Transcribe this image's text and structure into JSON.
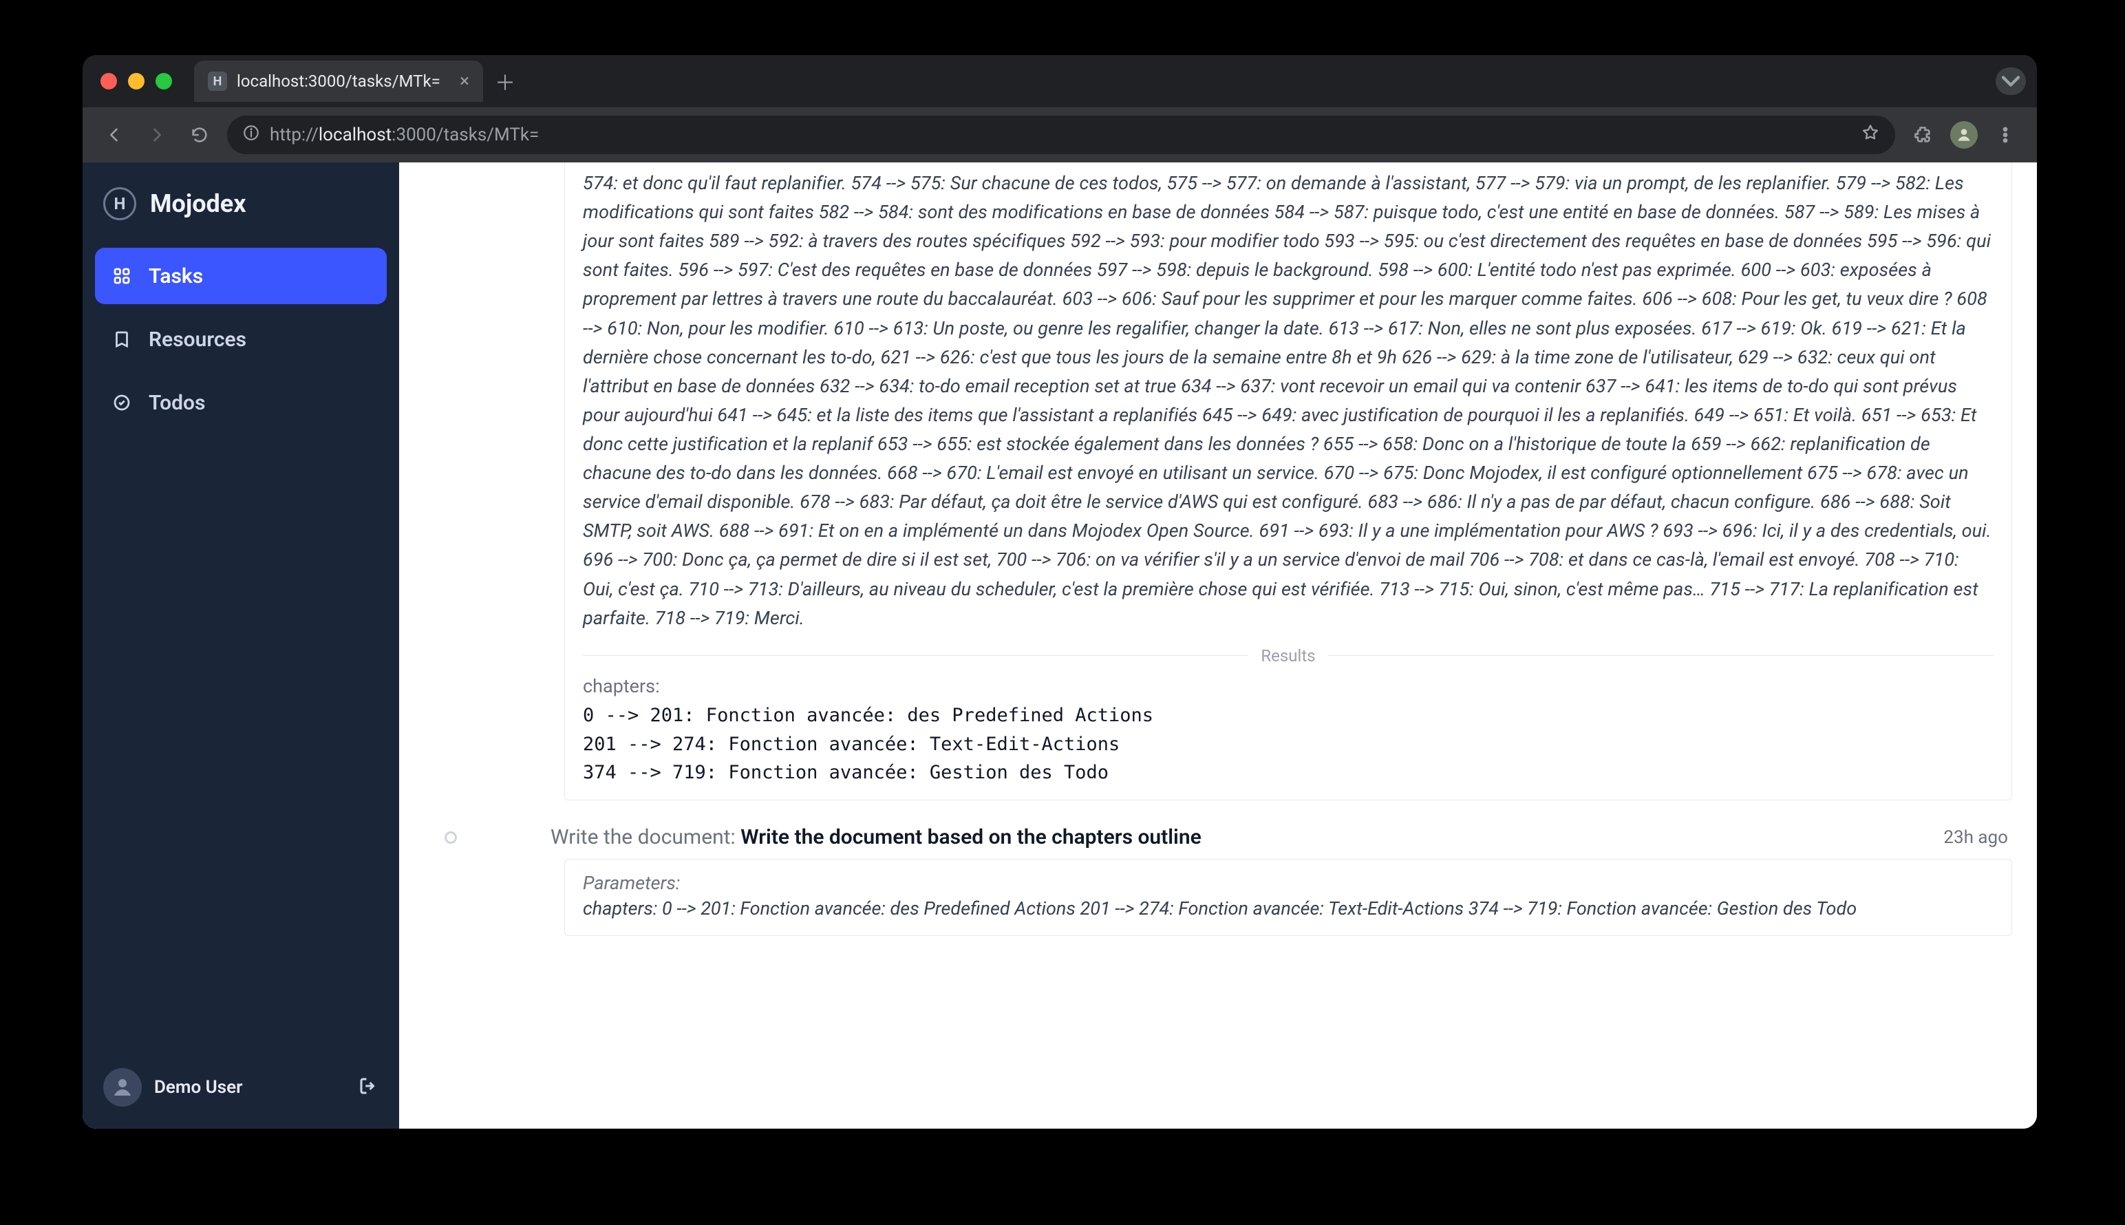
{
  "chrome": {
    "tab_title": "localhost:3000/tasks/MTk=",
    "favicon_letter": "H",
    "url_scheme": "http://",
    "url_host": "localhost",
    "url_rest": ":3000/tasks/MTk="
  },
  "app": {
    "brand": "Mojodex",
    "nav": {
      "tasks": "Tasks",
      "resources": "Resources",
      "todos": "Todos"
    },
    "user": {
      "name": "Demo User"
    }
  },
  "content": {
    "transcript": "574: et donc qu'il faut replanifier. 574 --> 575: Sur chacune de ces todos, 575 --> 577: on demande à l'assistant, 577 --> 579: via un prompt, de les replanifier. 579 --> 582: Les modifications qui sont faites 582 --> 584: sont des modifications en base de données 584 --> 587: puisque todo, c'est une entité en base de données. 587 --> 589: Les mises à jour sont faites 589 --> 592: à travers des routes spécifiques 592 --> 593: pour modifier todo 593 --> 595: ou c'est directement des requêtes en base de données 595 --> 596: qui sont faites. 596 --> 597: C'est des requêtes en base de données 597 --> 598: depuis le background. 598 --> 600: L'entité todo n'est pas exprimée. 600 --> 603: exposées à proprement par lettres à travers une route du baccalauréat. 603 --> 606: Sauf pour les supprimer et pour les marquer comme faites. 606 --> 608: Pour les get, tu veux dire ? 608 --> 610: Non, pour les modifier. 610 --> 613: Un poste, ou genre les regalifier, changer la date. 613 --> 617: Non, elles ne sont plus exposées. 617 --> 619: Ok. 619 --> 621: Et la dernière chose concernant les to-do, 621 --> 626: c'est que tous les jours de la semaine entre 8h et 9h 626 --> 629: à la time zone de l'utilisateur, 629 --> 632: ceux qui ont l'attribut en base de données 632 --> 634: to-do email reception set at true 634 --> 637: vont recevoir un email qui va contenir 637 --> 641: les items de to-do qui sont prévus pour aujourd'hui 641 --> 645: et la liste des items que l'assistant a replanifiés 645 --> 649: avec justification de pourquoi il les a replanifiés. 649 --> 651: Et voilà. 651 --> 653: Et donc cette justification et la replanif 653 --> 655: est stockée également dans les données ? 655 --> 658: Donc on a l'historique de toute la 659 --> 662: replanification de chacune des to-do dans les données. 668 --> 670: L'email est envoyé en utilisant un service. 670 --> 675: Donc Mojodex, il est configuré optionnellement 675 --> 678: avec un service d'email disponible. 678 --> 683: Par défaut, ça doit être le service d'AWS qui est configuré. 683 --> 686: Il n'y a pas de par défaut, chacun configure. 686 --> 688: Soit SMTP, soit AWS. 688 --> 691: Et on en a implémenté un dans Mojodex Open Source. 691 --> 693: Il y a une implémentation pour AWS ? 693 --> 696: Ici, il y a des credentials, oui. 696 --> 700: Donc ça, ça permet de dire si il est set, 700 --> 706: on va vérifier s'il y a un service d'envoi de mail 706 --> 708: et dans ce cas-là, l'email est envoyé. 708 --> 710: Oui, c'est ça. 710 --> 713: D'ailleurs, au niveau du scheduler, c'est la première chose qui est vérifiée. 713 --> 715: Oui, sinon, c'est même pas… 715 --> 717: La replanification est parfaite. 718 --> 719: Merci.",
    "results_label": "Results",
    "chapters_label": "chapters:",
    "chapters_lines": "0 --> 201: Fonction avancée: des Predefined Actions\n201 --> 274: Fonction avancée: Text-Edit-Actions\n374 --> 719: Fonction avancée: Gestion des Todo",
    "step2": {
      "prefix": "Write the document: ",
      "title": "Write the document based on the chapters outline",
      "time": "23h ago"
    },
    "params_label": "Parameters:",
    "params_text": "chapters: 0 --> 201: Fonction avancée: des Predefined Actions 201 --> 274: Fonction avancée: Text-Edit-Actions 374 --> 719: Fonction avancée: Gestion des Todo"
  }
}
